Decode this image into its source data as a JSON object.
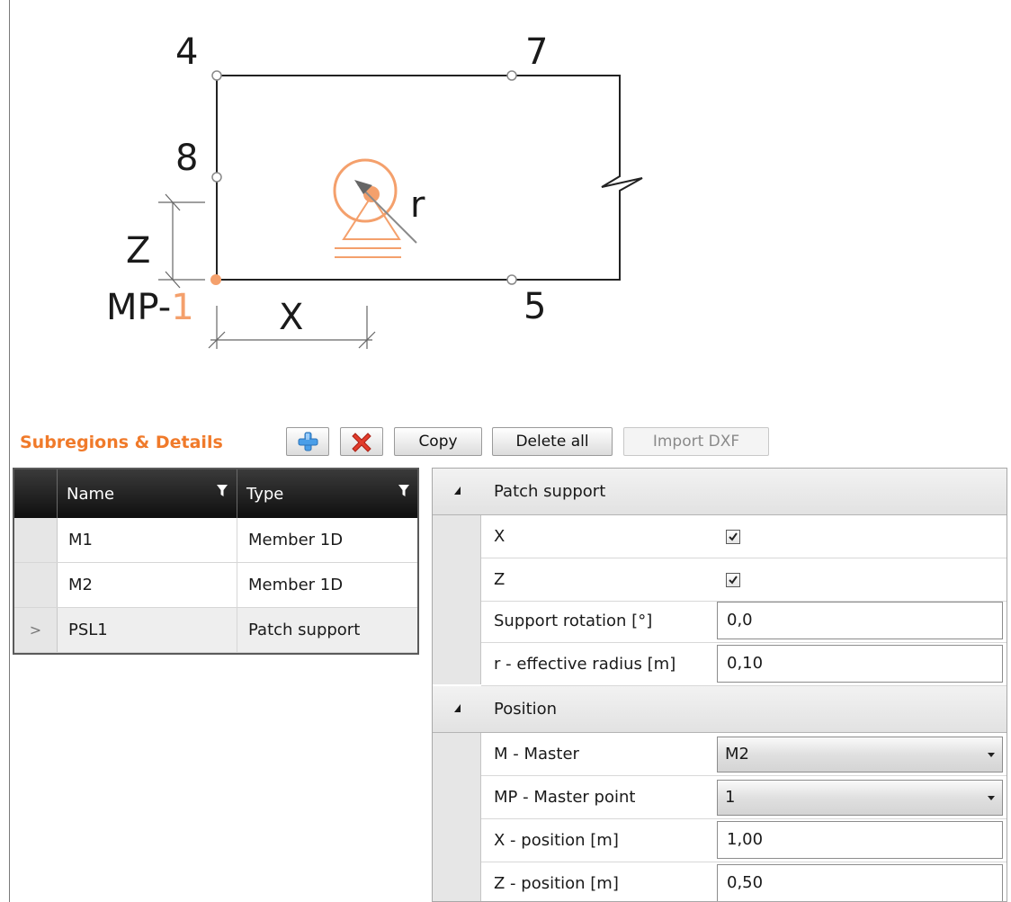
{
  "diagram": {
    "point_labels": [
      "4",
      "7",
      "8",
      "5"
    ],
    "radius_label": "r",
    "dim_z_label": "Z",
    "dim_x_label": "X",
    "master_point_prefix": "MP-",
    "master_point_index": "1",
    "accent_color": "#f4a06c"
  },
  "toolbar": {
    "title": "Subregions & Details",
    "add_icon": "plus-icon",
    "delete_icon": "red-x-icon",
    "copy_label": "Copy",
    "delete_all_label": "Delete all",
    "import_dxf_label": "Import DXF",
    "title_color": "#f07a2a"
  },
  "grid": {
    "columns": [
      "Name",
      "Type"
    ],
    "rows": [
      {
        "indicator": "",
        "name": "M1",
        "type": "Member 1D"
      },
      {
        "indicator": "",
        "name": "M2",
        "type": "Member 1D"
      },
      {
        "indicator": ">",
        "name": "PSL1",
        "type": "Patch support"
      }
    ]
  },
  "props": {
    "patch": {
      "title": "Patch support",
      "x_label": "X",
      "x_checked": true,
      "z_label": "Z",
      "z_checked": true,
      "rotation_label": "Support rotation [°]",
      "rotation_value": "0,0",
      "radius_label": "r - effective radius [m]",
      "radius_value": "0,10"
    },
    "position": {
      "title": "Position",
      "master_label": "M - Master",
      "master_value": "M2",
      "master_point_label": "MP - Master point",
      "master_point_value": "1",
      "xpos_label": "X - position [m]",
      "xpos_value": "1,00",
      "zpos_label": "Z - position [m]",
      "zpos_value": "0,50"
    }
  }
}
